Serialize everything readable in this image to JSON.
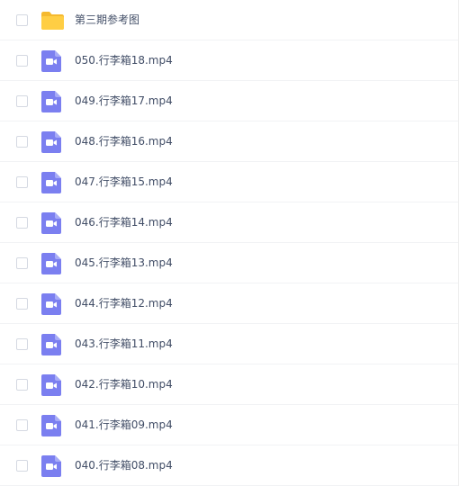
{
  "files": [
    {
      "name": "第三期参考图",
      "type": "folder",
      "icon": "folder-icon"
    },
    {
      "name": "050.行李箱18.mp4",
      "type": "video",
      "icon": "video-file-icon"
    },
    {
      "name": "049.行李箱17.mp4",
      "type": "video",
      "icon": "video-file-icon"
    },
    {
      "name": "048.行李箱16.mp4",
      "type": "video",
      "icon": "video-file-icon"
    },
    {
      "name": "047.行李箱15.mp4",
      "type": "video",
      "icon": "video-file-icon"
    },
    {
      "name": "046.行李箱14.mp4",
      "type": "video",
      "icon": "video-file-icon"
    },
    {
      "name": "045.行李箱13.mp4",
      "type": "video",
      "icon": "video-file-icon"
    },
    {
      "name": "044.行李箱12.mp4",
      "type": "video",
      "icon": "video-file-icon"
    },
    {
      "name": "043.行李箱11.mp4",
      "type": "video",
      "icon": "video-file-icon"
    },
    {
      "name": "042.行李箱10.mp4",
      "type": "video",
      "icon": "video-file-icon"
    },
    {
      "name": "041.行李箱09.mp4",
      "type": "video",
      "icon": "video-file-icon"
    },
    {
      "name": "040.行李箱08.mp4",
      "type": "video",
      "icon": "video-file-icon"
    }
  ],
  "colors": {
    "folder": "#ffce44",
    "folder_tab": "#f5b92e",
    "video": "#7b7ff0",
    "text": "#424e67",
    "divider": "#f1f2f4",
    "checkbox_border": "#d5d9e2"
  }
}
